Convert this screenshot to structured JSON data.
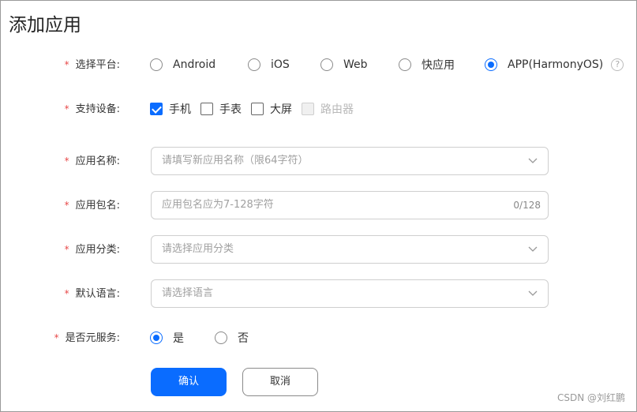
{
  "page": {
    "title": "添加应用"
  },
  "platform": {
    "label": "选择平台:",
    "options": [
      "Android",
      "iOS",
      "Web",
      "快应用",
      "APP(HarmonyOS)"
    ],
    "selected": "APP(HarmonyOS)",
    "help_icon": "?"
  },
  "devices": {
    "label": "支持设备:",
    "options": [
      {
        "label": "手机",
        "checked": true,
        "disabled": false
      },
      {
        "label": "手表",
        "checked": false,
        "disabled": false
      },
      {
        "label": "大屏",
        "checked": false,
        "disabled": false
      },
      {
        "label": "路由器",
        "checked": false,
        "disabled": true
      }
    ]
  },
  "app_name": {
    "label": "应用名称:",
    "placeholder": "请填写新应用名称（限64字符）"
  },
  "package_name": {
    "label": "应用包名:",
    "placeholder": "应用包名应为7-128字符",
    "counter": "0/128"
  },
  "category": {
    "label": "应用分类:",
    "placeholder": "请选择应用分类"
  },
  "language": {
    "label": "默认语言:",
    "placeholder": "请选择语言"
  },
  "meta_service": {
    "label": "是否元服务:",
    "options": [
      "是",
      "否"
    ],
    "selected": "是"
  },
  "required_mark": "*",
  "buttons": {
    "confirm": "确认",
    "cancel": "取消"
  },
  "watermark": "CSDN @刘红鹏",
  "colors": {
    "accent": "#0a6cff",
    "required": "#e84a4a"
  }
}
